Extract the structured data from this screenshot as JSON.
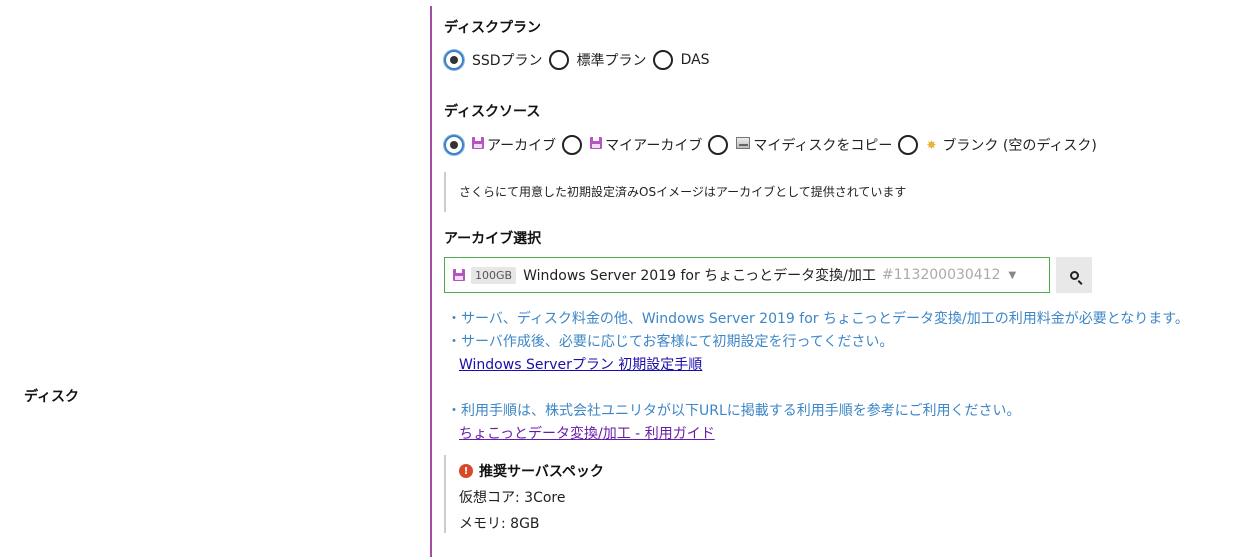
{
  "left_label": "ディスク",
  "disk_plan": {
    "title": "ディスクプラン",
    "options": [
      "SSDプラン",
      "標準プラン",
      "DAS"
    ],
    "selected": "SSDプラン"
  },
  "disk_source": {
    "title": "ディスクソース",
    "options": [
      {
        "label": "アーカイブ",
        "icon": "floppy-icon"
      },
      {
        "label": "マイアーカイブ",
        "icon": "floppy-icon"
      },
      {
        "label": "マイディスクをコピー",
        "icon": "hdd-icon"
      },
      {
        "label": "ブランク (空のディスク)",
        "icon": "sun-icon"
      }
    ],
    "selected": "アーカイブ",
    "info": "さくらにて用意した初期設定済みOSイメージはアーカイブとして提供されています"
  },
  "archive_select": {
    "title": "アーカイブ選択",
    "size": "100GB",
    "value": "Windows Server 2019 for ちょこっとデータ変換/加工",
    "id": "#113200030412"
  },
  "notes": {
    "line1": "・サーバ、ディスク料金の他、Windows Server 2019 for ちょこっとデータ変換/加工の利用料金が必要となります。",
    "line2": "・サーバ作成後、必要に応じてお客様にて初期設定を行ってください。",
    "link1": "Windows Serverプラン 初期設定手順",
    "line3": "・利用手順は、株式会社ユニリタが以下URLに掲載する利用手順を参考にご利用ください。",
    "link2": "ちょこっとデータ変換/加工 - 利用ガイド"
  },
  "spec": {
    "title": "推奨サーバスペック",
    "cpu": "仮想コア: 3Core",
    "memory": "メモリ: 8GB"
  },
  "colors": {
    "divider": "#a14fa5",
    "note_text": "#3d86c7",
    "select_border": "#4caa4c",
    "warn": "#d9482b"
  }
}
